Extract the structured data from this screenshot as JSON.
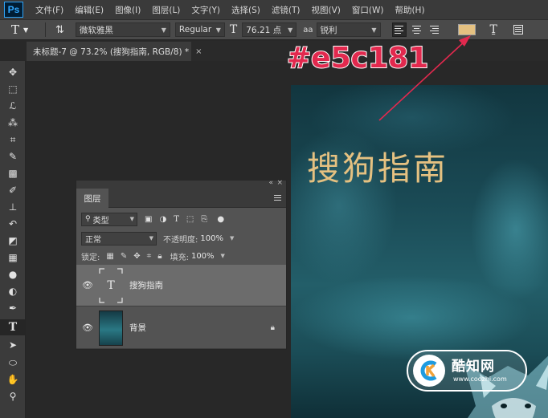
{
  "app": {
    "logo_text": "Ps"
  },
  "menu": [
    "文件(F)",
    "编辑(E)",
    "图像(I)",
    "图层(L)",
    "文字(Y)",
    "选择(S)",
    "滤镜(T)",
    "视图(V)",
    "窗口(W)",
    "帮助(H)"
  ],
  "options": {
    "font_family": "微软雅黑",
    "font_style": "Regular",
    "font_size": "76.21 点",
    "aa_label": "aa",
    "antialias": "锐利",
    "text_color": "#e5c181"
  },
  "document": {
    "tab_title": "未标题-7 @ 73.2% (搜狗指南, RGB/8) *",
    "close": "×"
  },
  "canvas": {
    "title_text": "搜狗指南",
    "title_color": "#e5c181"
  },
  "annotation": {
    "hex_text": "#e5c181",
    "color": "#e2294e"
  },
  "layers_panel": {
    "tab": "图层",
    "filter_label": "类型",
    "blend_mode": "正常",
    "opacity_label": "不透明度:",
    "opacity_value": "100%",
    "lock_label": "锁定:",
    "fill_label": "填充:",
    "fill_value": "100%",
    "layers": [
      {
        "name": "搜狗指南",
        "kind": "text",
        "thumb_glyph": "T",
        "selected": true
      },
      {
        "name": "背景",
        "kind": "image",
        "locked": true,
        "selected": false
      }
    ]
  },
  "watermark": {
    "title": "酷知网",
    "url": "www.coozhi.com"
  },
  "icons": [
    "text-tool-icon",
    "text-orientation-icon",
    "font-size-icon",
    "align-left-icon",
    "align-center-icon",
    "align-right-icon",
    "warp-text-icon",
    "character-panel-icon",
    "eye-icon",
    "lock-icon"
  ]
}
